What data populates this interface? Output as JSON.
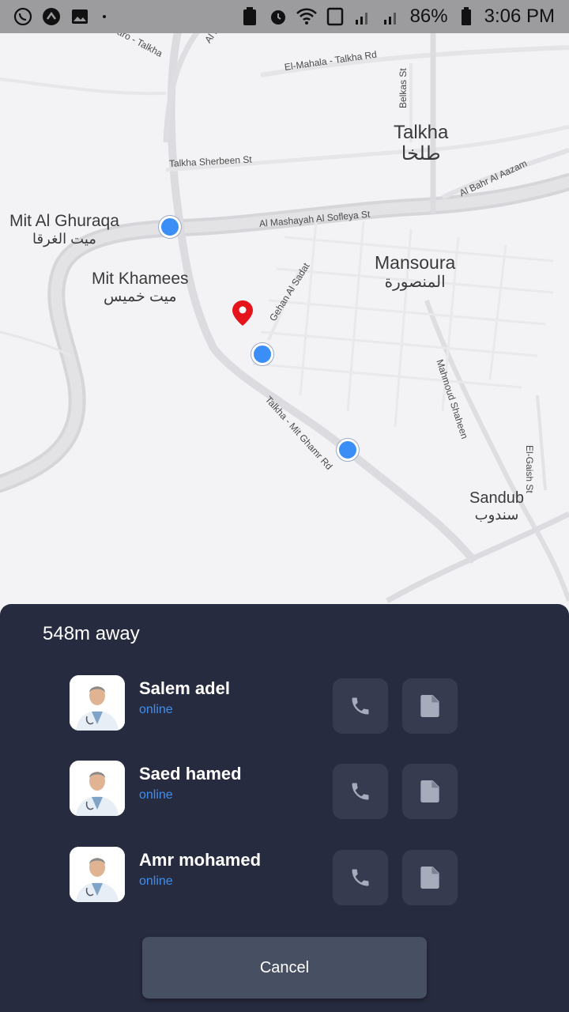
{
  "status_bar": {
    "battery": "86%",
    "time": "3:06 PM",
    "left_icons": [
      "whatsapp-icon",
      "app-icon",
      "image-icon"
    ],
    "right_icons": [
      "recycle-icon",
      "alarm-icon",
      "wifi-icon",
      "sd-card-icon",
      "signal-icon",
      "signal-icon",
      "battery-icon"
    ]
  },
  "map": {
    "places": [
      {
        "name": "Talkha",
        "arabic": "طلخا"
      },
      {
        "name": "Mit Al Ghuraqa",
        "arabic": "ميت الغرقا"
      },
      {
        "name": "Mit Khamees",
        "arabic": "ميت خميس"
      },
      {
        "name": "Mansoura",
        "arabic": "المنصورة"
      },
      {
        "name": "Sandub",
        "arabic": "سندوب"
      }
    ],
    "roads": [
      "Nabaro - Talkha",
      "Al Mansoura",
      "El-Mahala - Talkha Rd",
      "Belkas St",
      "Talkha Sherbeen St",
      "Al Bahr Al Aazam",
      "Al Mashayah Al Sofleya St",
      "Gehan Al Sadat",
      "Mahmoud Shaheen",
      "Talkha - Mit Ghamr Rd",
      "El-Gaish St"
    ],
    "colors": {
      "marker": "#3b8ef5",
      "pin": "#e5141b"
    }
  },
  "sheet": {
    "distance": "548m away",
    "doctors": [
      {
        "name": "Salem adel",
        "status": "online"
      },
      {
        "name": "Saed hamed",
        "status": "online"
      },
      {
        "name": "Amr mohamed",
        "status": "online"
      }
    ],
    "cancel_label": "Cancel",
    "colors": {
      "background": "#272b3f",
      "status": "#3f8ff0",
      "button": "#474f63"
    }
  }
}
